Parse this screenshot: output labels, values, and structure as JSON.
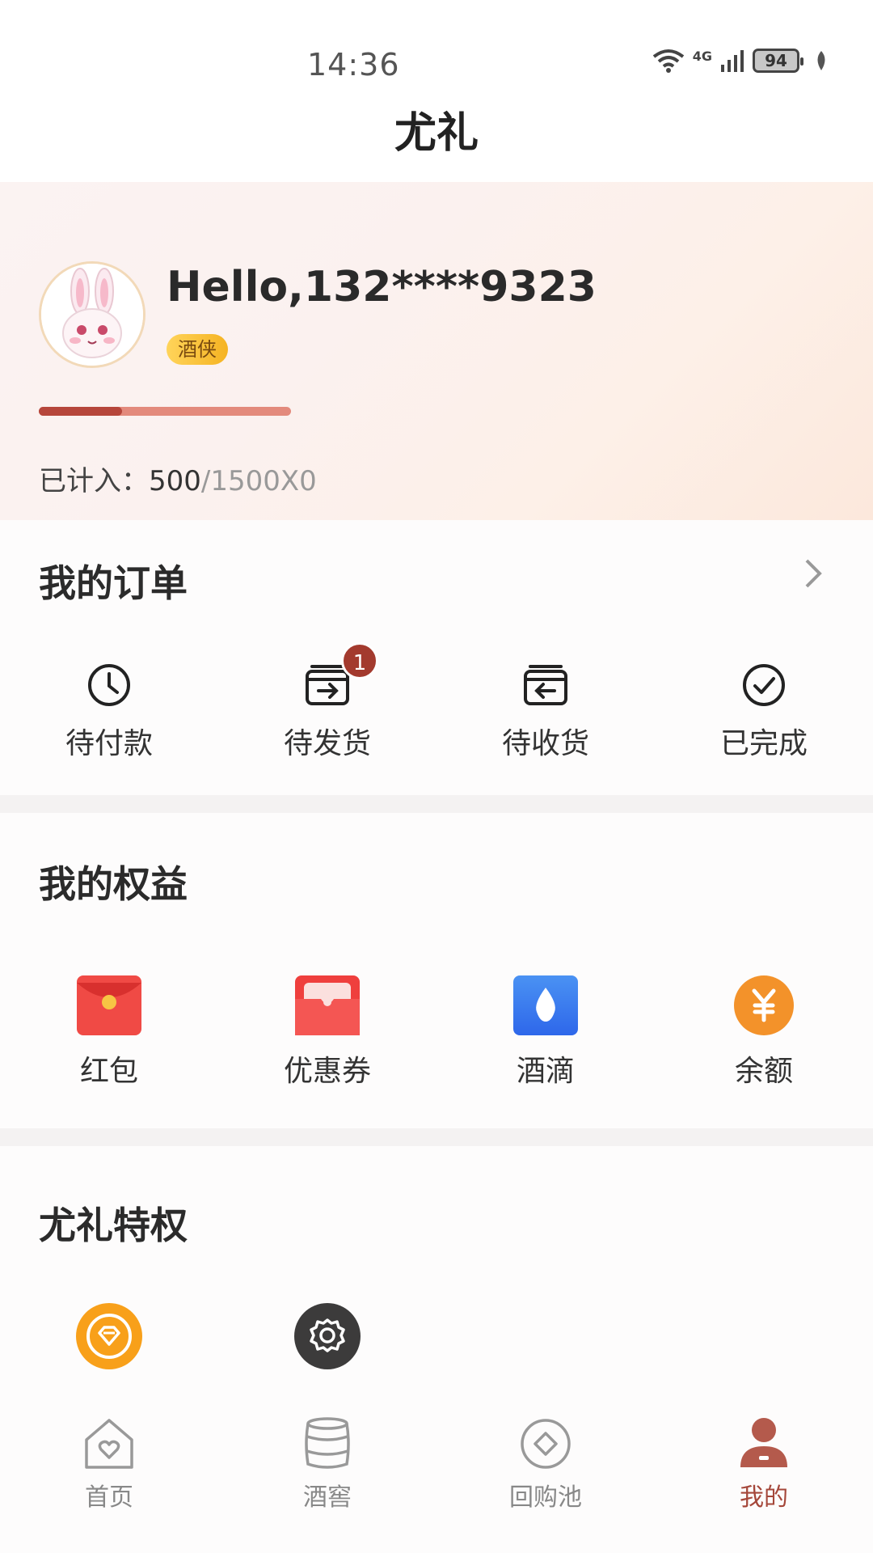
{
  "status_bar": {
    "time": "14:36",
    "network": "4G",
    "battery": "94"
  },
  "nav": {
    "title": "尤礼"
  },
  "profile": {
    "greeting": "Hello,132****9323",
    "level": "酒侠",
    "progress_fraction": 0.33,
    "counted_label": "已计入：",
    "counted_current": "500",
    "counted_total": "/1500X0"
  },
  "orders": {
    "title": "我的订单",
    "items": [
      {
        "label": "待付款",
        "icon": "clock-icon"
      },
      {
        "label": "待发货",
        "icon": "box-out-icon",
        "badge": "1"
      },
      {
        "label": "待收货",
        "icon": "box-in-icon"
      },
      {
        "label": "已完成",
        "icon": "check-circle-icon"
      }
    ]
  },
  "benefits": {
    "title": "我的权益",
    "items": [
      {
        "label": "红包",
        "icon": "red-envelope-icon"
      },
      {
        "label": "优惠券",
        "icon": "coupon-icon"
      },
      {
        "label": "酒滴",
        "icon": "drop-icon"
      },
      {
        "label": "余额",
        "icon": "yuan-coin-icon"
      }
    ]
  },
  "privileges": {
    "title": "尤礼特权",
    "items": [
      {
        "icon": "diamond-icon"
      },
      {
        "icon": "settings-icon"
      }
    ]
  },
  "tabbar": {
    "items": [
      {
        "label": "首页",
        "icon": "home-heart-icon"
      },
      {
        "label": "酒窖",
        "icon": "barrel-icon"
      },
      {
        "label": "回购池",
        "icon": "target-icon"
      },
      {
        "label": "我的",
        "icon": "user-icon",
        "active": true
      }
    ]
  },
  "colors": {
    "accent": "#a5473a",
    "progress_fill": "#b6463b",
    "progress_track": "#e38a7c",
    "badge": "#a33a2e"
  }
}
